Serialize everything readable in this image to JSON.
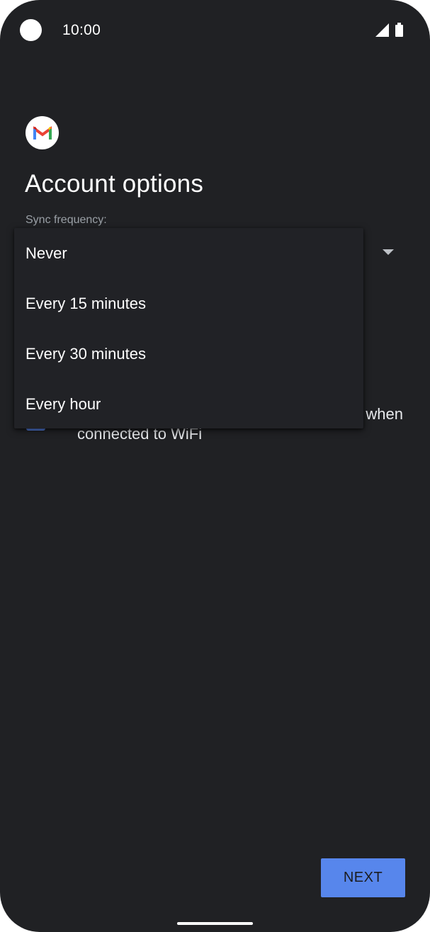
{
  "status_bar": {
    "time": "10:00",
    "icons": [
      "camera-cutout",
      "signal-icon",
      "battery-icon"
    ]
  },
  "app": {
    "logo_icon": "gmail-logo",
    "title": "Account options"
  },
  "sync": {
    "label": "Sync frequency:",
    "options": [
      "Never",
      "Every 15 minutes",
      "Every 30 minutes",
      "Every hour"
    ]
  },
  "wifi_option": {
    "text_visible_line1": "when",
    "text_line2": "connected to WiFi",
    "checked": true
  },
  "footer": {
    "next_label": "NEXT"
  },
  "colors": {
    "background": "#202124",
    "accent": "#5786ec",
    "menu_background": "#212226"
  }
}
